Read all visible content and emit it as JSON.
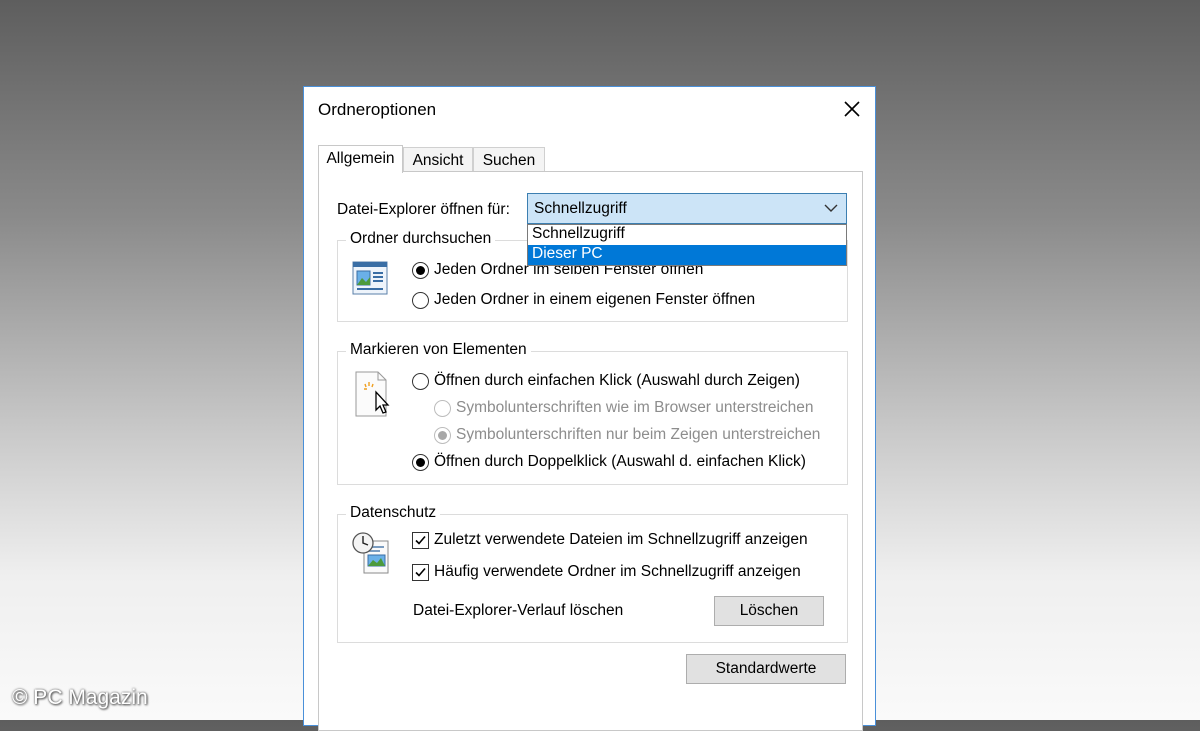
{
  "window": {
    "title": "Ordneroptionen"
  },
  "tabs": [
    {
      "label": "Allgemein",
      "active": true
    },
    {
      "label": "Ansicht",
      "active": false
    },
    {
      "label": "Suchen",
      "active": false
    }
  ],
  "open_for": {
    "label": "Datei-Explorer öffnen für:",
    "value": "Schnellzugriff",
    "options": [
      "Schnellzugriff",
      "Dieser PC"
    ],
    "highlighted": "Dieser PC"
  },
  "browse_group": {
    "title": "Ordner durchsuchen",
    "options": [
      {
        "label": "Jeden Ordner im selben Fenster öffnen",
        "selected": true
      },
      {
        "label": "Jeden Ordner in einem eigenen Fenster öffnen",
        "selected": false
      }
    ]
  },
  "click_group": {
    "title": "Markieren von Elementen",
    "options": [
      {
        "label": "Öffnen durch einfachen Klick (Auswahl durch Zeigen)",
        "selected": false
      },
      {
        "label": "Symbolunterschriften wie im Browser unterstreichen",
        "selected": false,
        "disabled": true
      },
      {
        "label": "Symbolunterschriften nur beim Zeigen unterstreichen",
        "selected": true,
        "disabled": true
      },
      {
        "label": "Öffnen durch Doppelklick (Auswahl d. einfachen Klick)",
        "selected": true
      }
    ]
  },
  "privacy_group": {
    "title": "Datenschutz",
    "checkboxes": [
      {
        "label": "Zuletzt verwendete Dateien im Schnellzugriff anzeigen",
        "checked": true
      },
      {
        "label": "Häufig verwendete Ordner im Schnellzugriff anzeigen",
        "checked": true
      }
    ],
    "clear_label": "Datei-Explorer-Verlauf löschen",
    "clear_button": "Löschen"
  },
  "defaults_button": "Standardwerte",
  "watermark": "© PC Magazin",
  "colors": {
    "accent": "#0078d7",
    "combo_bg": "#cce4f7",
    "window_border": "#4a90d9"
  }
}
